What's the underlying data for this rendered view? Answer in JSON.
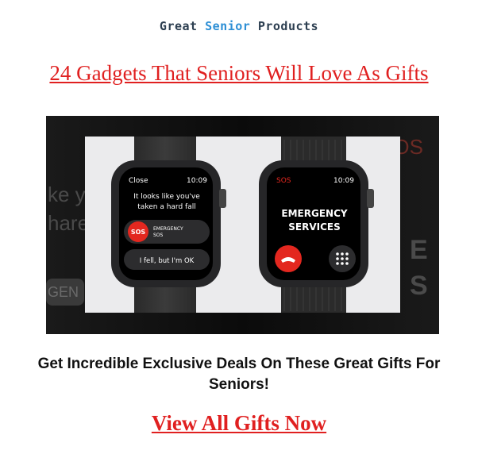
{
  "brand": {
    "part1": "Great ",
    "part2": "Senior",
    "part3": " Products"
  },
  "headline": "24 Gadgets That Seniors Will Love As Gifts",
  "hero": {
    "bg_left_text1": "ke y",
    "bg_left_text2": "hare",
    "bg_left_text3": "GEN",
    "bg_right_top": "SOS",
    "bg_right_mid1": "E",
    "bg_right_mid2": "S",
    "watch_left": {
      "close_label": "Close",
      "time": "10:09",
      "message": [
        "It looks like you've",
        "taken a hard fall"
      ],
      "sos_badge": "SOS",
      "emergency_label": [
        "EMERGENCY",
        "SOS"
      ],
      "ok_label": "I fell, but I'm OK"
    },
    "watch_right": {
      "sos_label": "SOS",
      "time": "10:09",
      "title": [
        "EMERGENCY",
        "SERVICES"
      ]
    }
  },
  "cta_text": "Get Incredible Exclusive Deals On These Great Gifts For Seniors!",
  "cta_link": "View All Gifts Now",
  "colors": {
    "accent_red": "#e02020",
    "brand_dark": "#2c3e50",
    "brand_blue": "#2d8fd5"
  }
}
